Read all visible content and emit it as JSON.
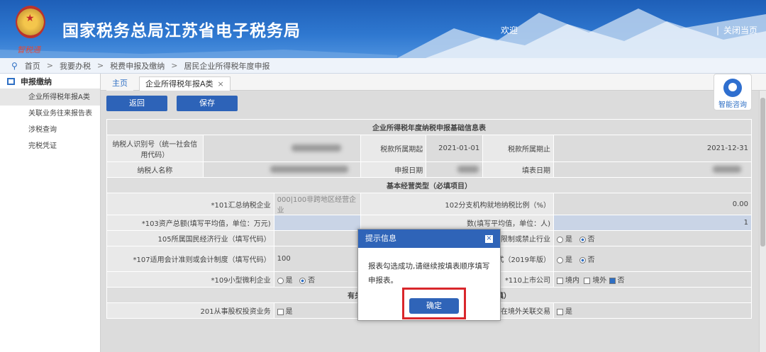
{
  "header": {
    "title": "国家税务总局江苏省电子税务局",
    "brand": "智税通",
    "welcome": "欢迎",
    "close_page": "关闭当页"
  },
  "breadcrumb": [
    "首页",
    "我要办税",
    "税费申报及缴纳",
    "居民企业所得税年度申报"
  ],
  "sidebar": {
    "title": "申报缴纳",
    "items": [
      {
        "label": "企业所得税年报A类",
        "active": true
      },
      {
        "label": "关联业务往来报告表",
        "active": false
      },
      {
        "label": "涉税查询",
        "active": false
      },
      {
        "label": "完税凭证",
        "active": false
      }
    ]
  },
  "tabs": [
    {
      "label": "主页"
    },
    {
      "label": "企业所得税年报A类"
    }
  ],
  "toolbar": {
    "back_label": "返回",
    "save_label": "保存"
  },
  "help": {
    "label": "智能咨询"
  },
  "form": {
    "title": "企业所得税年度纳税申报基础信息表",
    "taxpayer_id_label": "纳税人识别号（统一社会信用代码）",
    "period_start_label": "税款所属期起",
    "period_start": "2021-01-01",
    "period_end_label": "税款所属期止",
    "period_end": "2021-12-31",
    "taxpayer_name_label": "纳税人名称",
    "declare_date_label": "申报日期",
    "fill_date_label": "填表日期",
    "section_basic": "基本经营类型（必填项目）",
    "f101_label": "*101汇总纳税企业",
    "f101_value": "000|100非跨地区经营企业",
    "f102_label": "102分支机构就地纳税比例（%）",
    "f102_value": "0.00",
    "f103_label": "*103资产总额(填写平均值，单位：万元)",
    "f104_label": "数(填写平均值，单位：人)",
    "f104_value": "1",
    "f105_label": "105所属国民经济行业（填写代码）",
    "f106_label": "106从事国家限制或禁止行业",
    "f107_label": "*107适用会计准则或会计制度（填写代码）",
    "f107_value": "100",
    "f108_label": "业财务报表格式（2019年版）",
    "f109_label": "*109小型微利企业",
    "f110_label": "*110上市公司",
    "opt_yes": "是",
    "opt_no": "否",
    "opt_domestic": "境内",
    "opt_overseas": "境外",
    "section_related": "有关涉税事项情况（存在或者发生下列事项时必填）",
    "f201_label": "201从事股权投资业务",
    "f202_label": "202存在境外关联交易"
  },
  "dialog": {
    "title": "提示信息",
    "close": "×",
    "message": "报表勾选成功,请继续按填表顺序填写申报表。",
    "ok_label": "确定"
  }
}
